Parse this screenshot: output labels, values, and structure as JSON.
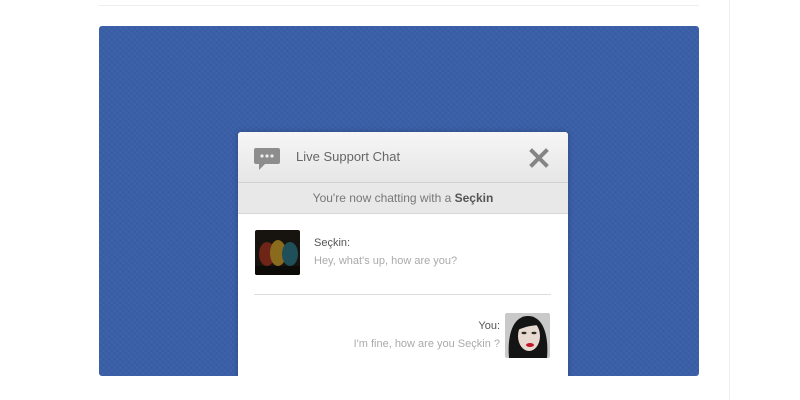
{
  "chat": {
    "title": "Live Support Chat",
    "status_prefix": "You're now chatting with a ",
    "agent_name": "Seçkin",
    "icons": {
      "chat": "speech-bubble-icon",
      "close": "close-icon"
    }
  },
  "messages": [
    {
      "sender": "Seçkin:",
      "text": "Hey, what's up, how are you?"
    },
    {
      "sender": "You:",
      "text": "I'm fine, how are you Seçkin ?"
    }
  ],
  "colors": {
    "panel_background": "#3a5fa8",
    "widget_header": "#ececec",
    "text_muted": "#aaaaaa"
  }
}
